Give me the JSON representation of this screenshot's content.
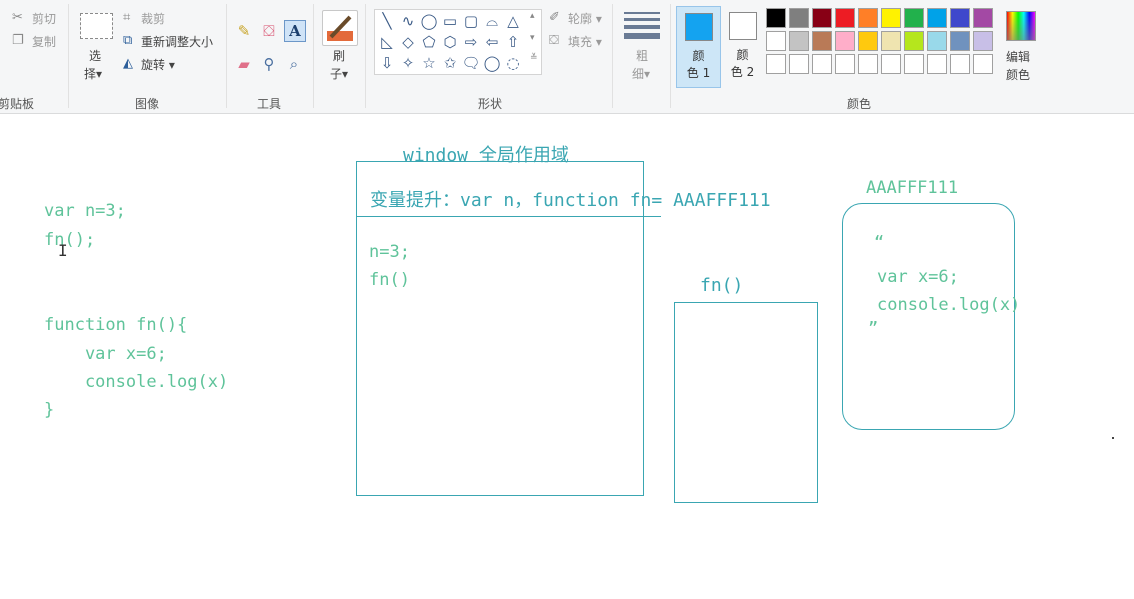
{
  "ribbon": {
    "clipboard": {
      "cut": "剪切",
      "copy": "复制",
      "label": "剪贴板"
    },
    "image": {
      "select_line1": "选",
      "select_line2": "择▾",
      "crop": "裁剪",
      "resize": "重新调整大小",
      "rotate": "旋转 ▾",
      "label": "图像"
    },
    "tools": {
      "label": "工具",
      "text_tool": "A"
    },
    "brush": {
      "line1": "刷",
      "line2": "子▾"
    },
    "shapes": {
      "outline": "轮廓 ▾",
      "fill": "填充 ▾",
      "label": "形状",
      "glyphs": [
        "╲",
        "∿",
        "◯",
        "▭",
        "▢",
        "⌓",
        "△",
        "◺",
        "◇",
        "⬠",
        "⬡",
        "⇨",
        "⇦",
        "⇧",
        "⇩",
        "✧",
        "☆",
        "✩",
        "🗨",
        "◯",
        "◌"
      ]
    },
    "size": {
      "line1": "粗",
      "line2": "细▾"
    },
    "color1": {
      "line1": "颜",
      "line2": "色 1",
      "swatch": "#14a3f0"
    },
    "color2": {
      "line1": "颜",
      "line2": "色 2",
      "swatch": "#ffffff"
    },
    "colors_label": "颜色",
    "palette_row1": [
      "#000000",
      "#7f7f7f",
      "#880015",
      "#ed1c24",
      "#ff7f27",
      "#fff200",
      "#22b14c",
      "#00a2e8",
      "#3f48cc",
      "#a349a4"
    ],
    "palette_row2": [
      "#ffffff",
      "#c3c3c3",
      "#b97a57",
      "#ffaec9",
      "#ffc90e",
      "#efe4b0",
      "#b5e61d",
      "#99d9ea",
      "#7092be",
      "#c8bfe7"
    ],
    "palette_row3": [
      "#ffffff",
      "#ffffff",
      "#ffffff",
      "#ffffff",
      "#ffffff",
      "#ffffff",
      "#ffffff",
      "#ffffff",
      "#ffffff",
      "#ffffff"
    ],
    "edit_colors_line1": "编辑",
    "edit_colors_line2": "颜色"
  },
  "canvas": {
    "code": {
      "line1": "var n=3;",
      "line2": "fn();",
      "line3": "function fn(){",
      "line4": "    var x=6;",
      "line5": "    console.log(x)",
      "line6": "}"
    },
    "window_title": "window 全局作用域",
    "hoist_text": "变量提升：var n，function fn= AAAFFF111",
    "window_body_line1": "n=3;",
    "window_body_line2": "fn()",
    "fn_label": "fn()",
    "heap_label": "AAAFFF111",
    "heap_open_quote": "“",
    "heap_line1": "var x=6;",
    "heap_line2": "console.log(x)",
    "heap_close_quote": "”",
    "colors": {
      "green": "#5fc39a",
      "teal": "#3aa6b2"
    }
  }
}
